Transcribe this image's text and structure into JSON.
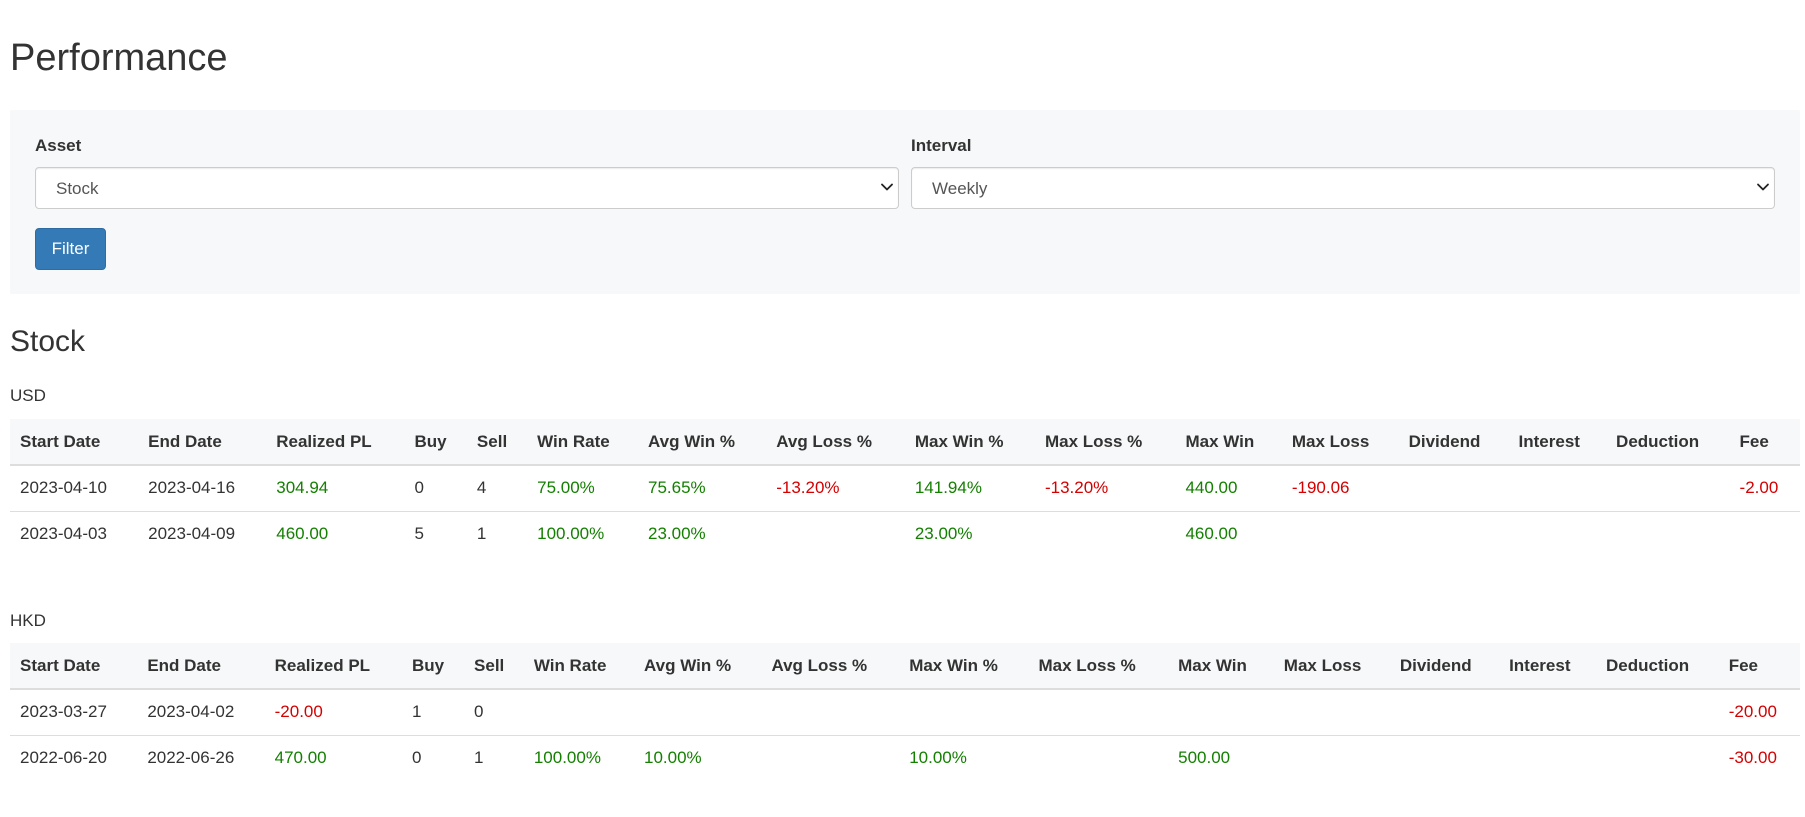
{
  "page": {
    "title": "Performance"
  },
  "filter": {
    "asset_label": "Asset",
    "asset_value": "Stock",
    "interval_label": "Interval",
    "interval_value": "Weekly",
    "button_label": "Filter"
  },
  "section": {
    "title": "Stock"
  },
  "colors": {
    "positive": "#138000",
    "negative": "#d50000",
    "primary_button": "#337ab7",
    "panel_background": "#f7f8f9"
  },
  "columns": [
    "Start Date",
    "End Date",
    "Realized PL",
    "Buy",
    "Sell",
    "Win Rate",
    "Avg Win %",
    "Avg Loss %",
    "Max Win %",
    "Max Loss %",
    "Max Win",
    "Max Loss",
    "Dividend",
    "Interest",
    "Deduction",
    "Fee"
  ],
  "tables": {
    "usd": {
      "currency": "USD",
      "rows": [
        {
          "start_date": "2023-04-10",
          "end_date": "2023-04-16",
          "realized_pl": "304.94",
          "buy": "0",
          "sell": "4",
          "win_rate": "75.00%",
          "avg_win_pct": "75.65%",
          "avg_loss_pct": "-13.20%",
          "max_win_pct": "141.94%",
          "max_loss_pct": "-13.20%",
          "max_win": "440.00",
          "max_loss": "-190.06",
          "dividend": "",
          "interest": "",
          "deduction": "",
          "fee": "-2.00"
        },
        {
          "start_date": "2023-04-03",
          "end_date": "2023-04-09",
          "realized_pl": "460.00",
          "buy": "5",
          "sell": "1",
          "win_rate": "100.00%",
          "avg_win_pct": "23.00%",
          "avg_loss_pct": "",
          "max_win_pct": "23.00%",
          "max_loss_pct": "",
          "max_win": "460.00",
          "max_loss": "",
          "dividend": "",
          "interest": "",
          "deduction": "",
          "fee": ""
        }
      ]
    },
    "hkd": {
      "currency": "HKD",
      "rows": [
        {
          "start_date": "2023-03-27",
          "end_date": "2023-04-02",
          "realized_pl": "-20.00",
          "buy": "1",
          "sell": "0",
          "win_rate": "",
          "avg_win_pct": "",
          "avg_loss_pct": "",
          "max_win_pct": "",
          "max_loss_pct": "",
          "max_win": "",
          "max_loss": "",
          "dividend": "",
          "interest": "",
          "deduction": "",
          "fee": "-20.00"
        },
        {
          "start_date": "2022-06-20",
          "end_date": "2022-06-26",
          "realized_pl": "470.00",
          "buy": "0",
          "sell": "1",
          "win_rate": "100.00%",
          "avg_win_pct": "10.00%",
          "avg_loss_pct": "",
          "max_win_pct": "10.00%",
          "max_loss_pct": "",
          "max_win": "500.00",
          "max_loss": "",
          "dividend": "",
          "interest": "",
          "deduction": "",
          "fee": "-30.00"
        }
      ]
    }
  }
}
